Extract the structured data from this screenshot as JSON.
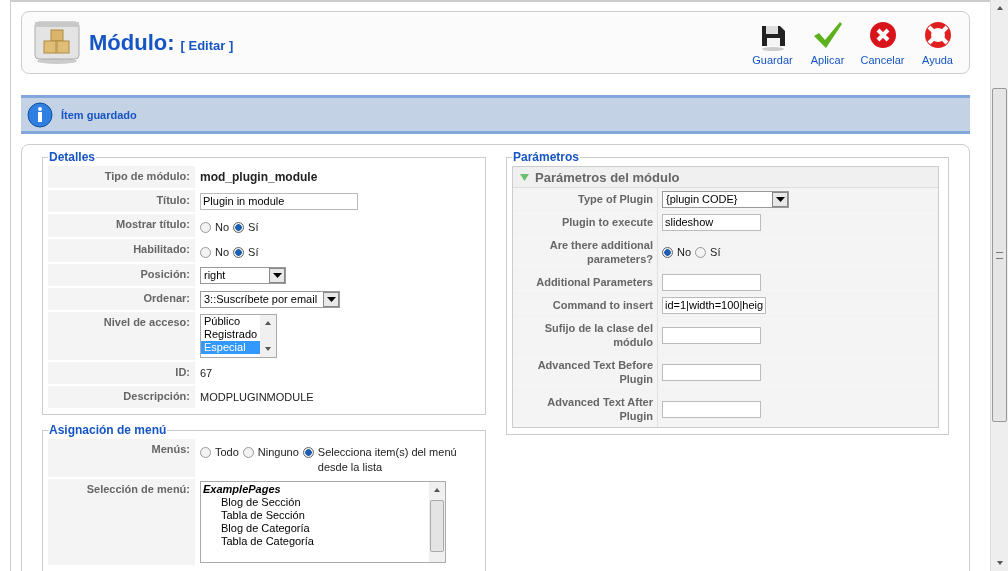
{
  "toolbar": {
    "title": "Módulo:",
    "subtitle": "[ Editar ]",
    "buttons": [
      {
        "label": "Guardar",
        "kind": "save"
      },
      {
        "label": "Aplicar",
        "kind": "apply"
      },
      {
        "label": "Cancelar",
        "kind": "cancel"
      },
      {
        "label": "Ayuda",
        "kind": "help"
      }
    ]
  },
  "message": "Ítem guardado",
  "details": {
    "legend": "Detalles",
    "rows": [
      {
        "label": "Tipo de módulo:",
        "kind": "strong",
        "value": "mod_plugin_module"
      },
      {
        "label": "Título:",
        "kind": "input",
        "value": "Plugin in module"
      },
      {
        "label": "Mostrar título:",
        "kind": "radio",
        "options": [
          {
            "label": "No",
            "selected": false
          },
          {
            "label": "Sí",
            "selected": true
          }
        ]
      },
      {
        "label": "Habilitado:",
        "kind": "radio",
        "options": [
          {
            "label": "No",
            "selected": false
          },
          {
            "label": "Sí",
            "selected": true
          }
        ]
      },
      {
        "label": "Posición:",
        "kind": "select",
        "value": "right"
      },
      {
        "label": "Ordenar:",
        "kind": "select",
        "value": "3::Suscríbete por email"
      },
      {
        "label": "Nivel de acceso:",
        "kind": "list",
        "options": [
          {
            "label": "Público",
            "selected": false
          },
          {
            "label": "Registrado",
            "selected": false
          },
          {
            "label": "Especial",
            "selected": true
          }
        ]
      },
      {
        "label": "ID:",
        "kind": "text",
        "value": "67"
      },
      {
        "label": "Descripción:",
        "kind": "text",
        "value": "MODPLUGINMODULE"
      }
    ]
  },
  "menu_assignment": {
    "legend": "Asignación de menú",
    "rows": [
      {
        "label": "Menús:",
        "kind": "radio",
        "options": [
          {
            "label": "Todo",
            "selected": false
          },
          {
            "label": "Ninguno",
            "selected": false
          },
          {
            "label": "Selecciona item(s) del menú desde la lista",
            "selected": true
          }
        ]
      },
      {
        "label": "Selección de menú:",
        "kind": "tree",
        "items": [
          {
            "label": "ExamplePages",
            "children": [
              {
                "label": "Blog de Sección"
              },
              {
                "label": "Tabla de Sección"
              },
              {
                "label": "Blog de Categoría"
              },
              {
                "label": "Tabla de Categoría"
              }
            ]
          }
        ]
      }
    ]
  },
  "parameters": {
    "legend": "Parámetros",
    "panel": {
      "title": "Parámetros del módulo",
      "expanded": true,
      "rows": [
        {
          "label": "Type of Plugin",
          "kind": "select",
          "value": "{plugin CODE}"
        },
        {
          "label": "Plugin to execute",
          "kind": "input",
          "value": "slideshow"
        },
        {
          "label": "Are there additional parameters?",
          "kind": "radio",
          "options": [
            {
              "label": "No",
              "selected": true
            },
            {
              "label": "Sí",
              "selected": false
            }
          ]
        },
        {
          "label": "Additional Parameters",
          "kind": "input",
          "value": ""
        },
        {
          "label": "Command to insert",
          "kind": "input",
          "value": "id=1|width=100|heig"
        },
        {
          "label": "Sufijo de la clase del módulo",
          "kind": "input",
          "value": ""
        },
        {
          "label": "Advanced Text Before Plugin",
          "kind": "input",
          "value": ""
        },
        {
          "label": "Advanced Text After Plugin",
          "kind": "input",
          "value": ""
        }
      ]
    }
  }
}
